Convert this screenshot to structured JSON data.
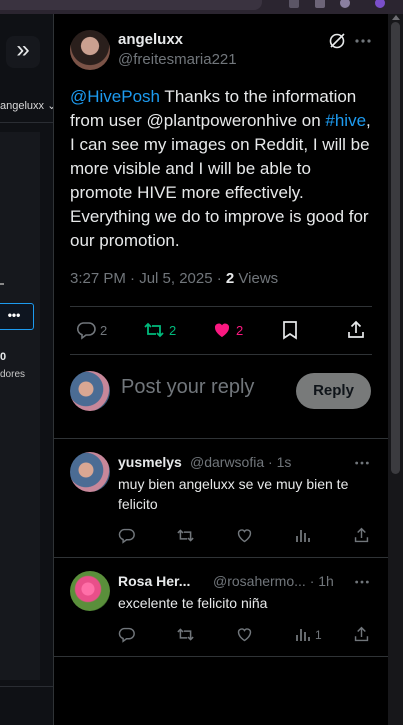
{
  "left_panel": {
    "collapse_glyph": "»",
    "user_chip": "angeluxx ⌄",
    "more_label": "•••",
    "count": "0",
    "count_label": "dores"
  },
  "post": {
    "author_name": "angeluxx",
    "author_handle": "@freitesmaria221",
    "text_parts": {
      "mention_hive": "@HivePosh",
      "part1": " Thanks to the information from user @plantpoweronhive on ",
      "hashtag": "#hive",
      "part2": ", I can see my images on Reddit, I will be more visible and I will be able to promote HIVE more effectively. Everything we do to improve is good for our promotion."
    },
    "time": "3:27 PM · Jul 5, 2025 · ",
    "views_count": "2",
    "views_label": " Views",
    "stats": {
      "replies": "2",
      "reposts": "2",
      "likes": "2"
    }
  },
  "compose": {
    "placeholder": "Post your reply",
    "reply_button": "Reply"
  },
  "replies": [
    {
      "name": "yusmelys",
      "handle": "@darwsofia · 1s",
      "text": "muy bien angeluxx se ve muy bien te felicito",
      "views": ""
    },
    {
      "name": "Rosa Her...",
      "handle": "@rosahermo... · 1h",
      "text": "excelente te felicito niña",
      "views": "1"
    }
  ],
  "colors": {
    "background": "#000000",
    "link": "#1d9bf0",
    "repost_active": "#00ba7c",
    "like_active": "#f91880",
    "muted": "#71767b",
    "reply_button_bg": "#787a7a"
  },
  "icons": {
    "grok": "grok-icon",
    "more": "more-dots-icon",
    "reply": "reply-icon",
    "repost": "repost-icon",
    "like": "heart-icon",
    "bookmark": "bookmark-icon",
    "share": "share-icon",
    "views": "views-icon"
  }
}
